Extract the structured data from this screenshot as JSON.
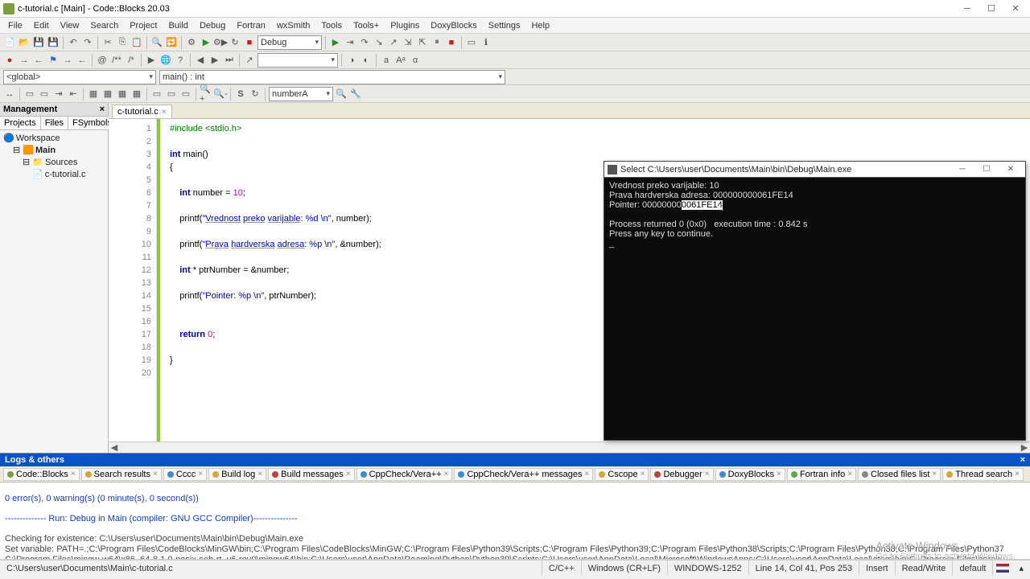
{
  "title": "c-tutorial.c [Main] - Code::Blocks 20.03",
  "menu": [
    "File",
    "Edit",
    "View",
    "Search",
    "Project",
    "Build",
    "Debug",
    "Fortran",
    "wxSmith",
    "Tools",
    "Tools+",
    "Plugins",
    "DoxyBlocks",
    "Settings",
    "Help"
  ],
  "build_target": "Debug",
  "scope_left": "<global>",
  "scope_right": "main() : int",
  "symbol_combo": "numberA",
  "management": {
    "title": "Management",
    "tabs": [
      "Projects",
      "Files",
      "FSymbols"
    ],
    "workspace": "Workspace",
    "project": "Main",
    "folder": "Sources",
    "file": "c-tutorial.c"
  },
  "editor_tab": "c-tutorial.c",
  "code_lines": [
    {
      "n": 1,
      "html": "<span class='pp'>#include &lt;stdio.h&gt;</span>"
    },
    {
      "n": 2,
      "html": ""
    },
    {
      "n": 3,
      "html": "<span class='kw'>int</span> main()"
    },
    {
      "n": 4,
      "html": "{"
    },
    {
      "n": 5,
      "html": ""
    },
    {
      "n": 6,
      "html": "    <span class='kw'>int</span> number = <span class='num'>10</span>;"
    },
    {
      "n": 7,
      "html": ""
    },
    {
      "n": 8,
      "html": "    printf(<span class='str'>\"<span class='und'>Vrednost</span> <span class='und'>preko</span> <span class='und'>varijable</span>: %d \\n\"</span>, number);"
    },
    {
      "n": 9,
      "html": ""
    },
    {
      "n": 10,
      "html": "    printf(<span class='str'>\"<span class='und'>Prava</span> <span class='und'>hardverska</span> <span class='und'>adresa</span>: %p \\n\"</span>, &amp;number);"
    },
    {
      "n": 11,
      "html": ""
    },
    {
      "n": 12,
      "html": "    <span class='kw'>int</span> * ptrNumber = &amp;number;"
    },
    {
      "n": 13,
      "html": ""
    },
    {
      "n": 14,
      "html": "    printf(<span class='str'>\"Pointer: %p \\n\"</span>, ptrNumber);"
    },
    {
      "n": 15,
      "html": ""
    },
    {
      "n": 16,
      "html": ""
    },
    {
      "n": 17,
      "html": "    <span class='kw'>return</span> <span class='num'>0</span>;"
    },
    {
      "n": 18,
      "html": ""
    },
    {
      "n": 19,
      "html": "}"
    },
    {
      "n": 20,
      "html": ""
    }
  ],
  "logs": {
    "title": "Logs & others",
    "tabs": [
      {
        "label": "Code::Blocks",
        "color": "#7aa03c"
      },
      {
        "label": "Search results",
        "color": "#d9a23c"
      },
      {
        "label": "Cccc",
        "color": "#3c8cd9"
      },
      {
        "label": "Build log",
        "color": "#d9a23c"
      },
      {
        "label": "Build messages",
        "color": "#c04040"
      },
      {
        "label": "CppCheck/Vera++",
        "color": "#3c8cd9"
      },
      {
        "label": "CppCheck/Vera++ messages",
        "color": "#3c8cd9"
      },
      {
        "label": "Cscope",
        "color": "#d9a23c"
      },
      {
        "label": "Debugger",
        "color": "#c04040"
      },
      {
        "label": "DoxyBlocks",
        "color": "#3c8cd9"
      },
      {
        "label": "Fortran info",
        "color": "#5ea84a"
      },
      {
        "label": "Closed files list",
        "color": "#888"
      },
      {
        "label": "Thread search",
        "color": "#d9a23c"
      }
    ],
    "summary": "0 error(s), 0 warning(s) (0 minute(s), 0 second(s))",
    "run_header": "-------------- Run: Debug in Main (compiler: GNU GCC Compiler)---------------",
    "body": "Checking for existence: C:\\Users\\user\\Documents\\Main\\bin\\Debug\\Main.exe\nSet variable: PATH=.;C:\\Program Files\\CodeBlocks\\MinGW\\bin;C:\\Program Files\\CodeBlocks\\MinGW;C:\\Program Files\\Python39\\Scripts;C:\\Program Files\\Python39;C:\\Program Files\\Python38\\Scripts;C:\\Program Files\\Python38;C:\\Program Files\\Python37\nC:\\Program Files\\mingw-w64\\x86_64-8.1.0-posix-seh-rt_v6-rev0\\mingw64\\bin;C:\\Users\\user\\AppData\\Roaming\\Python\\Python39\\Scripts;C:\\Users\\user\\AppData\\Local\\Microsoft\\WindowsApps;C:\\Users\\user\\AppData\\Local\\atom\\bin;C:\\Program Files\\heroku\n\\bin;C:\\Users\\user\\.dotnet\\tools;C:\\Program Files\\JetBrains\\PyCharm Community Edition 2020.3.4\\bin;C:\\Python38-64;C:\\Python38-64\\Scripts\nExecuting: \"C:\\Program Files\\CodeBlocks/cb_console_runner.exe\" \"C:\\Users\\user\\Documents\\Main\\bin\\Debug\\Main.exe\"  (in C:\\Users\\user\\Documents\\Main\\.)"
  },
  "status": {
    "path": "C:\\Users\\user\\Documents\\Main\\c-tutorial.c",
    "lang": "C/C++",
    "eol": "Windows (CR+LF)",
    "enc": "WINDOWS-1252",
    "pos": "Line 14, Col 41, Pos 253",
    "ins": "Insert",
    "rw": "Read/Write",
    "cfg": "default"
  },
  "console": {
    "title": "Select C:\\Users\\user\\Documents\\Main\\bin\\Debug\\Main.exe",
    "l1": "Vrednost preko varijable: 10",
    "l2": "Prava hardverska adresa: 000000000061FE14",
    "l3a": "Pointer: 00000000",
    "l3b": "0061FE14",
    "l4": "Process returned 0 (0x0)   execution time : 0.842 s",
    "l5": "Press any key to continue."
  },
  "watermark": {
    "l1": "Activate Windows",
    "l2": "Go to Settings to activate Windows."
  }
}
